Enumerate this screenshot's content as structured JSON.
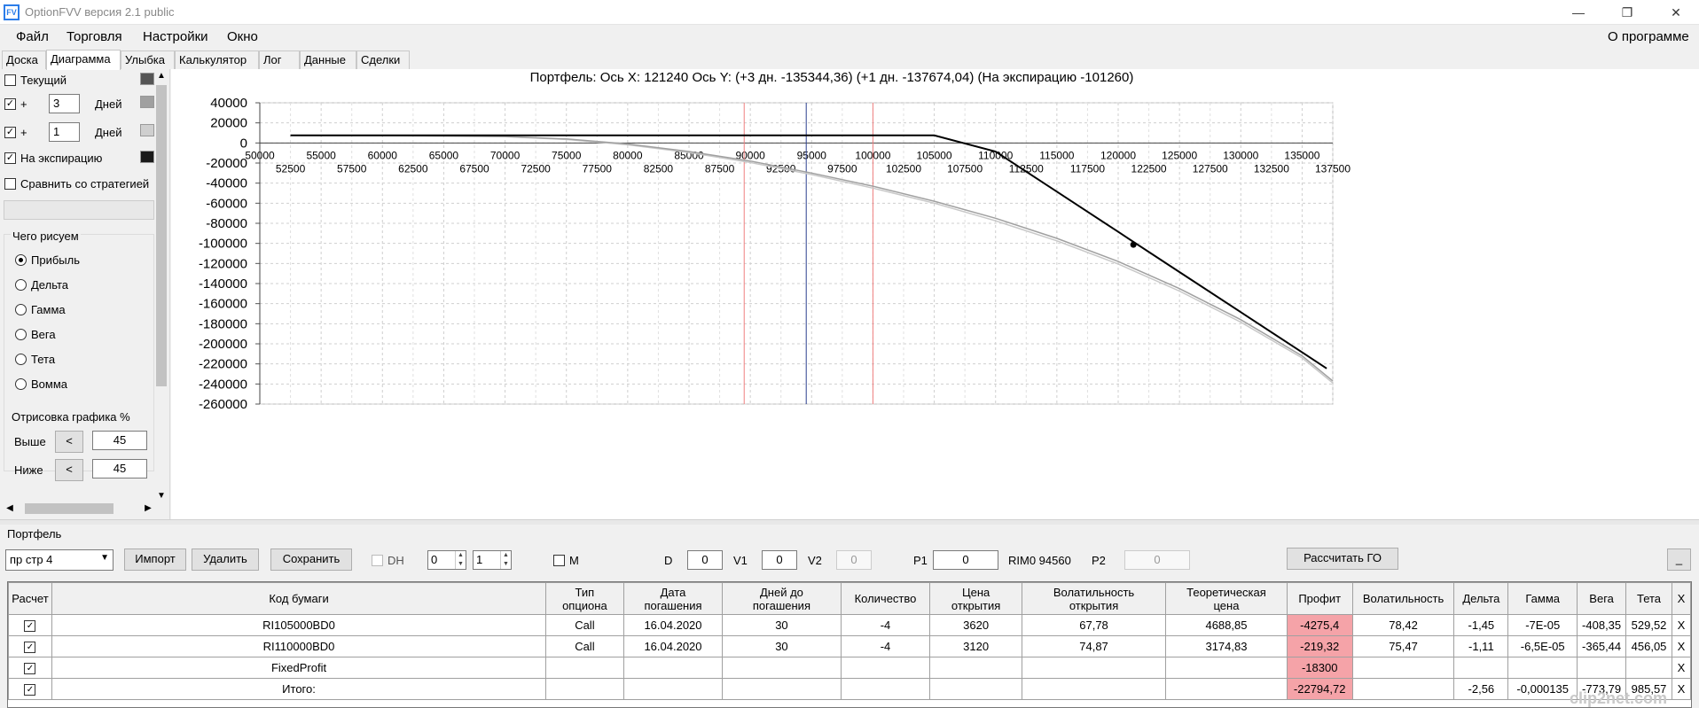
{
  "window": {
    "title": "OptionFVV версия 2.1 public",
    "min_glyph": "—",
    "max_glyph": "❐",
    "close_glyph": "✕"
  },
  "menu": {
    "items": [
      "Файл",
      "Торговля",
      "Настройки",
      "Окно"
    ],
    "about": "О программе"
  },
  "tabs": [
    "Доска",
    "Диаграмма",
    "Улыбка",
    "Калькулятор",
    "Лог",
    "Данные",
    "Сделки"
  ],
  "active_tab": "Диаграмма",
  "left_panel": {
    "current_label": "Текущий",
    "plus_label": "+",
    "days_label": "Дней",
    "days1": "3",
    "days2": "1",
    "expiry_label": "На экспирацию",
    "compare_label": "Сравнить со стратегией",
    "draw_group": "Чего рисуем",
    "radios": [
      "Прибыль",
      "Дельта",
      "Гамма",
      "Вега",
      "Тета",
      "Вомма"
    ],
    "selected_radio": "Прибыль",
    "render_group": "Отрисовка графика %",
    "above_label": "Выше",
    "below_label": "Ниже",
    "above_value": "45",
    "below_value": "45",
    "arrow_btn": "<",
    "swatch_colors": [
      "#555555",
      "#a0a0a0",
      "#cfcfcf",
      "#1a1a1a"
    ]
  },
  "chart_data": {
    "type": "line",
    "title": "Портфель: Ось X: 121240 Ось Y:  (+3 дн. -135344,36)  (+1 дн. -137674,04)  (На экспирацию -101260)",
    "xlim": [
      50000,
      137500
    ],
    "ylim": [
      -260000,
      40000
    ],
    "y_ticks": [
      40000,
      20000,
      0,
      -20000,
      -40000,
      -60000,
      -80000,
      -100000,
      -120000,
      -140000,
      -160000,
      -180000,
      -200000,
      -220000,
      -240000,
      -260000
    ],
    "x_ticks_upper": [
      50000,
      55000,
      60000,
      65000,
      70000,
      75000,
      80000,
      85000,
      90000,
      95000,
      100000,
      105000,
      110000,
      115000,
      120000,
      125000,
      130000,
      135000
    ],
    "x_ticks_lower": [
      52500,
      57500,
      62500,
      67500,
      72500,
      77500,
      82500,
      87500,
      92500,
      97500,
      102500,
      107500,
      112500,
      117500,
      122500,
      127500,
      132500,
      137500
    ],
    "grid": true,
    "vlines": [
      {
        "x": 89500,
        "color": "#f08080"
      },
      {
        "x": 94560,
        "color": "#2b3f8f"
      },
      {
        "x": 100000,
        "color": "#f08080"
      }
    ],
    "marker": {
      "x": 121240,
      "y": -101260
    },
    "series": [
      {
        "color": "#000000",
        "x": [
          52500,
          70000,
          90000,
          105000,
          110000,
          115000,
          120000,
          125000,
          130000,
          135000,
          137000
        ],
        "y": [
          7500,
          7500,
          7500,
          7500,
          -8500,
          -48500,
          -88500,
          -128500,
          -168500,
          -208500,
          -224500
        ]
      },
      {
        "color": "#a0a0a0",
        "x": [
          52500,
          60000,
          70000,
          75000,
          80000,
          85000,
          90000,
          95000,
          100000,
          105000,
          110000,
          115000,
          120000,
          125000,
          130000,
          135000,
          137500
        ],
        "y": [
          7500,
          7400,
          6500,
          4000,
          -1000,
          -8500,
          -18000,
          -30000,
          -43000,
          -58000,
          -75000,
          -95000,
          -118000,
          -145000,
          -176000,
          -212000,
          -237000
        ]
      },
      {
        "color": "#c8c8c8",
        "x": [
          52500,
          60000,
          70000,
          75000,
          80000,
          85000,
          90000,
          95000,
          100000,
          105000,
          110000,
          115000,
          120000,
          125000,
          130000,
          135000,
          137500
        ],
        "y": [
          7500,
          7300,
          6200,
          3500,
          -1800,
          -9500,
          -19500,
          -31500,
          -45000,
          -60000,
          -77500,
          -97500,
          -120500,
          -147500,
          -178500,
          -214000,
          -239000
        ]
      }
    ]
  },
  "portfolio": {
    "label": "Портфель",
    "combo_value": "пр стр 4",
    "import": "Импорт",
    "delete": "Удалить",
    "save": "Сохранить",
    "dh": "DH",
    "spin1": "0",
    "spin2": "1",
    "m_label": "M",
    "d_label": "D",
    "d_value": "0",
    "v1_label": "V1",
    "v1_value": "0",
    "v2_label": "V2",
    "v2_value": "0",
    "p1_label": "P1",
    "p1_value": "0",
    "rim_label": "RIM0 94560",
    "p2_label": "P2",
    "p2_value": "0",
    "go_button": "Рассчитать ГО",
    "minimize": "_"
  },
  "grid": {
    "headers": [
      "Расчет",
      "Код бумаги",
      "Тип\nопциона",
      "Дата\nпогашения",
      "Дней до\nпогашения",
      "Количество",
      "Цена\nоткрытия",
      "Волатильность\nоткрытия",
      "Теоретическая\nцена",
      "Профит",
      "Волатильность",
      "Дельта",
      "Гамма",
      "Вега",
      "Тета",
      "X"
    ],
    "rows": [
      {
        "code": "RI105000BD0",
        "type": "Call",
        "date": "16.04.2020",
        "days": "30",
        "qty": "-4",
        "price": "3620",
        "vol_open": "67,78",
        "theo": "4688,85",
        "profit": "-4275,4",
        "vol": "78,42",
        "delta": "-1,45",
        "gamma": "-7E-05",
        "vega": "-408,35",
        "theta": "529,52",
        "x": "X"
      },
      {
        "code": "RI110000BD0",
        "type": "Call",
        "date": "16.04.2020",
        "days": "30",
        "qty": "-4",
        "price": "3120",
        "vol_open": "74,87",
        "theo": "3174,83",
        "profit": "-219,32",
        "vol": "75,47",
        "delta": "-1,11",
        "gamma": "-6,5E-05",
        "vega": "-365,44",
        "theta": "456,05",
        "x": "X"
      },
      {
        "code": "FixedProfit",
        "type": "",
        "date": "",
        "days": "",
        "qty": "",
        "price": "",
        "vol_open": "",
        "theo": "",
        "profit": "-18300",
        "vol": "",
        "delta": "",
        "gamma": "",
        "vega": "",
        "theta": "",
        "x": "X"
      },
      {
        "code": "Итого:",
        "type": "",
        "date": "",
        "days": "",
        "qty": "",
        "price": "",
        "vol_open": "",
        "theo": "",
        "profit": "-22794,72",
        "vol": "",
        "delta": "-2,56",
        "gamma": "-0,000135",
        "vega": "-773,79",
        "theta": "985,57",
        "x": "X"
      }
    ]
  },
  "watermark": "clip2net.com"
}
